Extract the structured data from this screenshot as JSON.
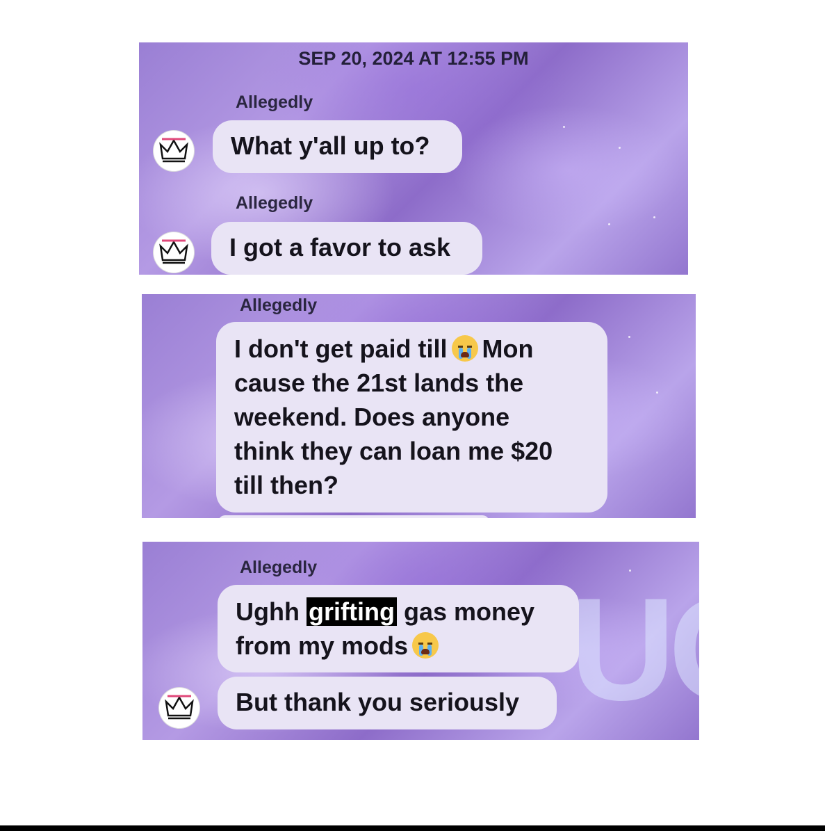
{
  "thread": {
    "timestamp": "SEP 20, 2024 AT 12:55 PM",
    "panel1": {
      "messages": [
        {
          "sender": "Allegedly",
          "text": "What y'all up to?"
        },
        {
          "sender": "Allegedly",
          "text": "I got a favor to ask"
        }
      ]
    },
    "panel2": {
      "sender": "Allegedly",
      "lines": {
        "l1a": "I don't get paid till",
        "l1b": "Mon",
        "l2": "cause the 21st lands the",
        "l3": "weekend.  Does anyone",
        "l4": "think they can loan me $20",
        "l5": "till then?"
      }
    },
    "panel3": {
      "sender": "Allegedly",
      "msg1": {
        "pre": "Ughh",
        "highlight": "grifting",
        "post": "gas money",
        "line2": "from my mods"
      },
      "msg2": "But thank you seriously"
    }
  },
  "icons": {
    "avatar": "crown-avatar-icon",
    "emoji": "loudly-crying-face-icon"
  },
  "colors": {
    "bubble": "#e9e4f5",
    "panel_purple": "#9a7fd4",
    "highlight_bg": "#000000"
  }
}
